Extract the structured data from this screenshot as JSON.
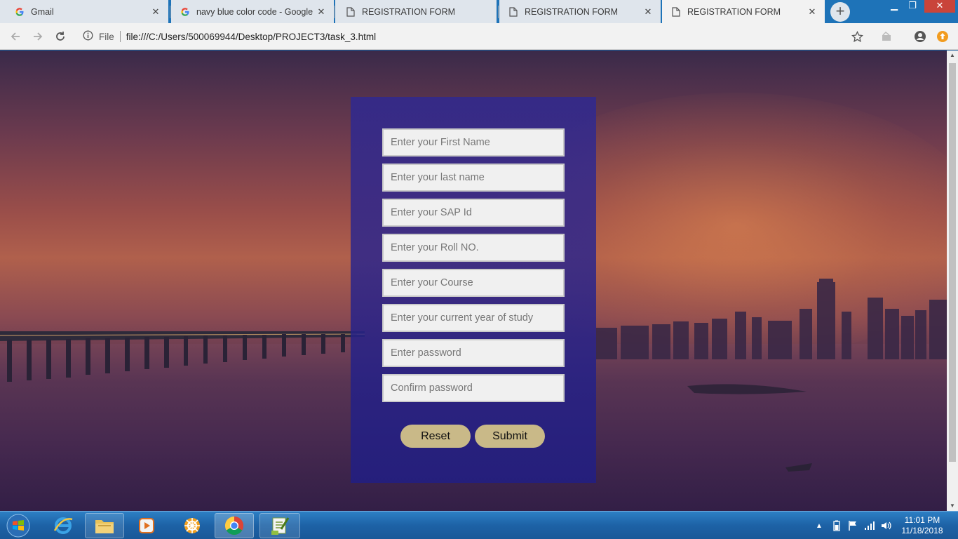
{
  "browser": {
    "tabs": [
      {
        "title": "Gmail",
        "icon": "google-icon"
      },
      {
        "title": "navy blue color code - Google S",
        "icon": "google-icon"
      },
      {
        "title": "REGISTRATION FORM",
        "icon": "page-icon"
      },
      {
        "title": "REGISTRATION FORM",
        "icon": "page-icon"
      },
      {
        "title": "REGISTRATION FORM",
        "icon": "page-icon",
        "active": true
      }
    ],
    "address": {
      "scheme_label": "File",
      "url": "file:///C:/Users/500069944/Desktop/PROJECT3/task_3.html"
    }
  },
  "form": {
    "fields": [
      {
        "placeholder": "Enter your First Name"
      },
      {
        "placeholder": "Enter your last name"
      },
      {
        "placeholder": "Enter your SAP Id"
      },
      {
        "placeholder": "Enter your Roll NO."
      },
      {
        "placeholder": "Enter your Course"
      },
      {
        "placeholder": "Enter your current year of study"
      },
      {
        "placeholder": "Enter password"
      },
      {
        "placeholder": "Confirm password"
      }
    ],
    "reset_label": "Reset",
    "submit_label": "Submit"
  },
  "taskbar": {
    "time": "11:01 PM",
    "date": "11/18/2018"
  },
  "colors": {
    "form_background": "#2c2896",
    "button_background": "#c9b988",
    "taskbar": "#1d62a6",
    "active_tab": "#f2f2f2"
  }
}
